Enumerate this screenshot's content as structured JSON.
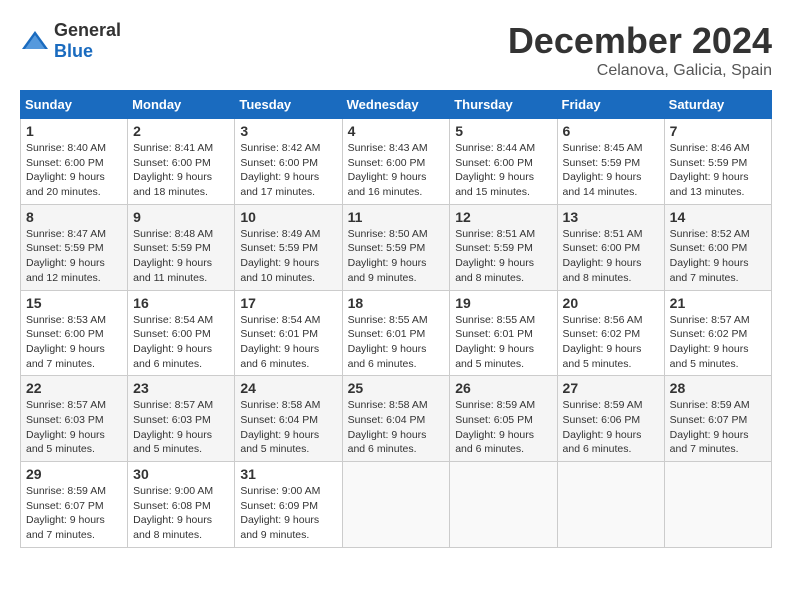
{
  "header": {
    "logo_general": "General",
    "logo_blue": "Blue",
    "month": "December 2024",
    "location": "Celanova, Galicia, Spain"
  },
  "calendar": {
    "days_of_week": [
      "Sunday",
      "Monday",
      "Tuesday",
      "Wednesday",
      "Thursday",
      "Friday",
      "Saturday"
    ],
    "weeks": [
      [
        {
          "day": "1",
          "sunrise": "8:40 AM",
          "sunset": "6:00 PM",
          "daylight": "9 hours and 20 minutes."
        },
        {
          "day": "2",
          "sunrise": "8:41 AM",
          "sunset": "6:00 PM",
          "daylight": "9 hours and 18 minutes."
        },
        {
          "day": "3",
          "sunrise": "8:42 AM",
          "sunset": "6:00 PM",
          "daylight": "9 hours and 17 minutes."
        },
        {
          "day": "4",
          "sunrise": "8:43 AM",
          "sunset": "6:00 PM",
          "daylight": "9 hours and 16 minutes."
        },
        {
          "day": "5",
          "sunrise": "8:44 AM",
          "sunset": "6:00 PM",
          "daylight": "9 hours and 15 minutes."
        },
        {
          "day": "6",
          "sunrise": "8:45 AM",
          "sunset": "5:59 PM",
          "daylight": "9 hours and 14 minutes."
        },
        {
          "day": "7",
          "sunrise": "8:46 AM",
          "sunset": "5:59 PM",
          "daylight": "9 hours and 13 minutes."
        }
      ],
      [
        {
          "day": "8",
          "sunrise": "8:47 AM",
          "sunset": "5:59 PM",
          "daylight": "9 hours and 12 minutes."
        },
        {
          "day": "9",
          "sunrise": "8:48 AM",
          "sunset": "5:59 PM",
          "daylight": "9 hours and 11 minutes."
        },
        {
          "day": "10",
          "sunrise": "8:49 AM",
          "sunset": "5:59 PM",
          "daylight": "9 hours and 10 minutes."
        },
        {
          "day": "11",
          "sunrise": "8:50 AM",
          "sunset": "5:59 PM",
          "daylight": "9 hours and 9 minutes."
        },
        {
          "day": "12",
          "sunrise": "8:51 AM",
          "sunset": "5:59 PM",
          "daylight": "9 hours and 8 minutes."
        },
        {
          "day": "13",
          "sunrise": "8:51 AM",
          "sunset": "6:00 PM",
          "daylight": "9 hours and 8 minutes."
        },
        {
          "day": "14",
          "sunrise": "8:52 AM",
          "sunset": "6:00 PM",
          "daylight": "9 hours and 7 minutes."
        }
      ],
      [
        {
          "day": "15",
          "sunrise": "8:53 AM",
          "sunset": "6:00 PM",
          "daylight": "9 hours and 7 minutes."
        },
        {
          "day": "16",
          "sunrise": "8:54 AM",
          "sunset": "6:00 PM",
          "daylight": "9 hours and 6 minutes."
        },
        {
          "day": "17",
          "sunrise": "8:54 AM",
          "sunset": "6:01 PM",
          "daylight": "9 hours and 6 minutes."
        },
        {
          "day": "18",
          "sunrise": "8:55 AM",
          "sunset": "6:01 PM",
          "daylight": "9 hours and 6 minutes."
        },
        {
          "day": "19",
          "sunrise": "8:55 AM",
          "sunset": "6:01 PM",
          "daylight": "9 hours and 5 minutes."
        },
        {
          "day": "20",
          "sunrise": "8:56 AM",
          "sunset": "6:02 PM",
          "daylight": "9 hours and 5 minutes."
        },
        {
          "day": "21",
          "sunrise": "8:57 AM",
          "sunset": "6:02 PM",
          "daylight": "9 hours and 5 minutes."
        }
      ],
      [
        {
          "day": "22",
          "sunrise": "8:57 AM",
          "sunset": "6:03 PM",
          "daylight": "9 hours and 5 minutes."
        },
        {
          "day": "23",
          "sunrise": "8:57 AM",
          "sunset": "6:03 PM",
          "daylight": "9 hours and 5 minutes."
        },
        {
          "day": "24",
          "sunrise": "8:58 AM",
          "sunset": "6:04 PM",
          "daylight": "9 hours and 5 minutes."
        },
        {
          "day": "25",
          "sunrise": "8:58 AM",
          "sunset": "6:04 PM",
          "daylight": "9 hours and 6 minutes."
        },
        {
          "day": "26",
          "sunrise": "8:59 AM",
          "sunset": "6:05 PM",
          "daylight": "9 hours and 6 minutes."
        },
        {
          "day": "27",
          "sunrise": "8:59 AM",
          "sunset": "6:06 PM",
          "daylight": "9 hours and 6 minutes."
        },
        {
          "day": "28",
          "sunrise": "8:59 AM",
          "sunset": "6:07 PM",
          "daylight": "9 hours and 7 minutes."
        }
      ],
      [
        {
          "day": "29",
          "sunrise": "8:59 AM",
          "sunset": "6:07 PM",
          "daylight": "9 hours and 7 minutes."
        },
        {
          "day": "30",
          "sunrise": "9:00 AM",
          "sunset": "6:08 PM",
          "daylight": "9 hours and 8 minutes."
        },
        {
          "day": "31",
          "sunrise": "9:00 AM",
          "sunset": "6:09 PM",
          "daylight": "9 hours and 9 minutes."
        },
        null,
        null,
        null,
        null
      ]
    ]
  }
}
